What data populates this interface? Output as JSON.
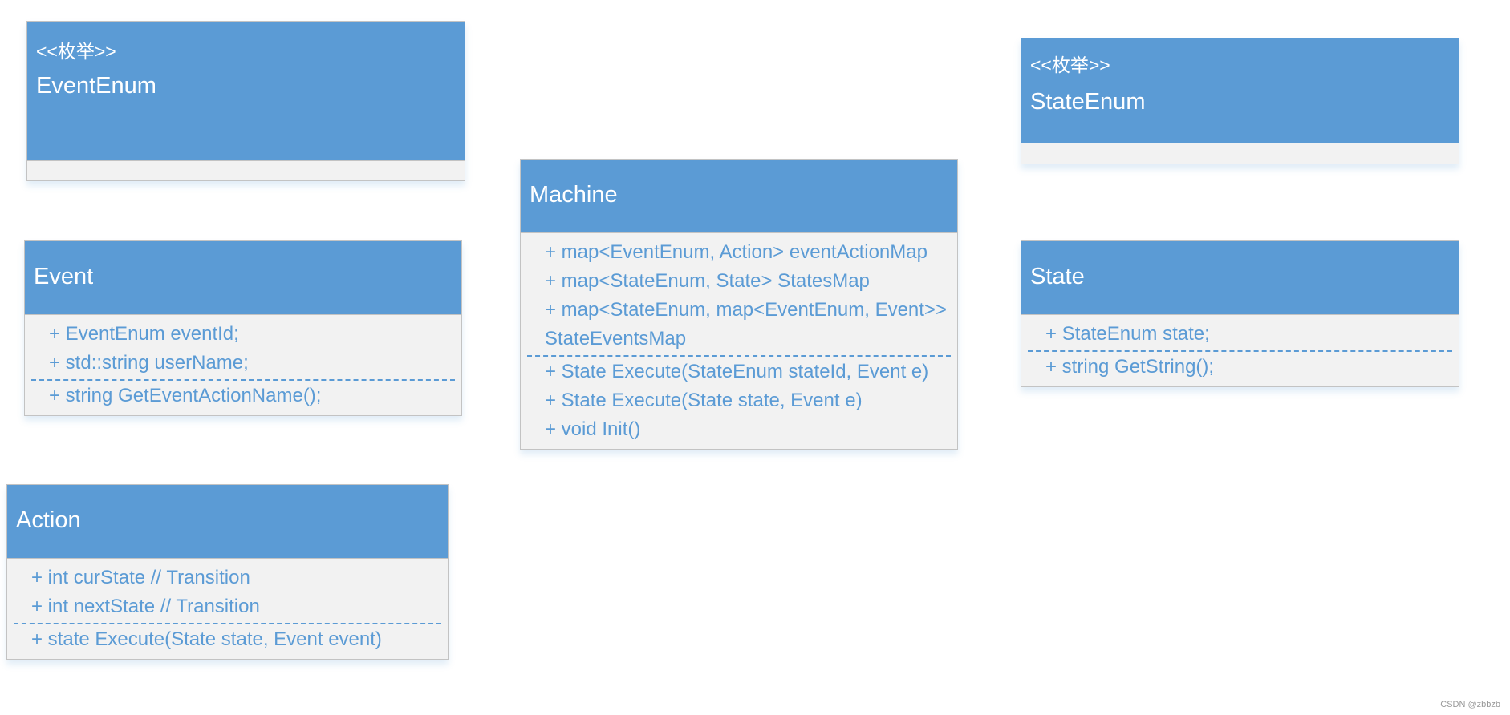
{
  "colors": {
    "header": "#5b9bd5",
    "body": "#f2f2f2",
    "text": "#5b9bd5"
  },
  "classes": {
    "event_enum": {
      "stereotype": "<<枚举>>",
      "name": "EventEnum",
      "attributes": [],
      "methods": []
    },
    "state_enum": {
      "stereotype": "<<枚举>>",
      "name": "StateEnum",
      "attributes": [],
      "methods": []
    },
    "event": {
      "name": "Event",
      "attributes": [
        "+ EventEnum eventId;",
        "+ std::string userName;"
      ],
      "methods": [
        "+ string GetEventActionName();"
      ]
    },
    "action": {
      "name": "Action",
      "attributes": [
        "+ int curState // Transition",
        "+ int nextState // Transition"
      ],
      "methods": [
        "+ state Execute(State state, Event event)"
      ]
    },
    "machine": {
      "name": "Machine",
      "attributes": [
        "+ map<EventEnum, Action> eventActionMap",
        "+ map<StateEnum, State> StatesMap",
        "+ map<StateEnum, map<EventEnum, Event>> StateEventsMap"
      ],
      "methods": [
        "+ State Execute(StateEnum stateId, Event e)",
        "+ State Execute(State state, Event e)",
        "+ void Init()"
      ]
    },
    "state": {
      "name": "State",
      "attributes": [
        "+ StateEnum state;"
      ],
      "methods": [
        "+ string GetString();"
      ]
    }
  },
  "watermark": "CSDN @zbbzb"
}
